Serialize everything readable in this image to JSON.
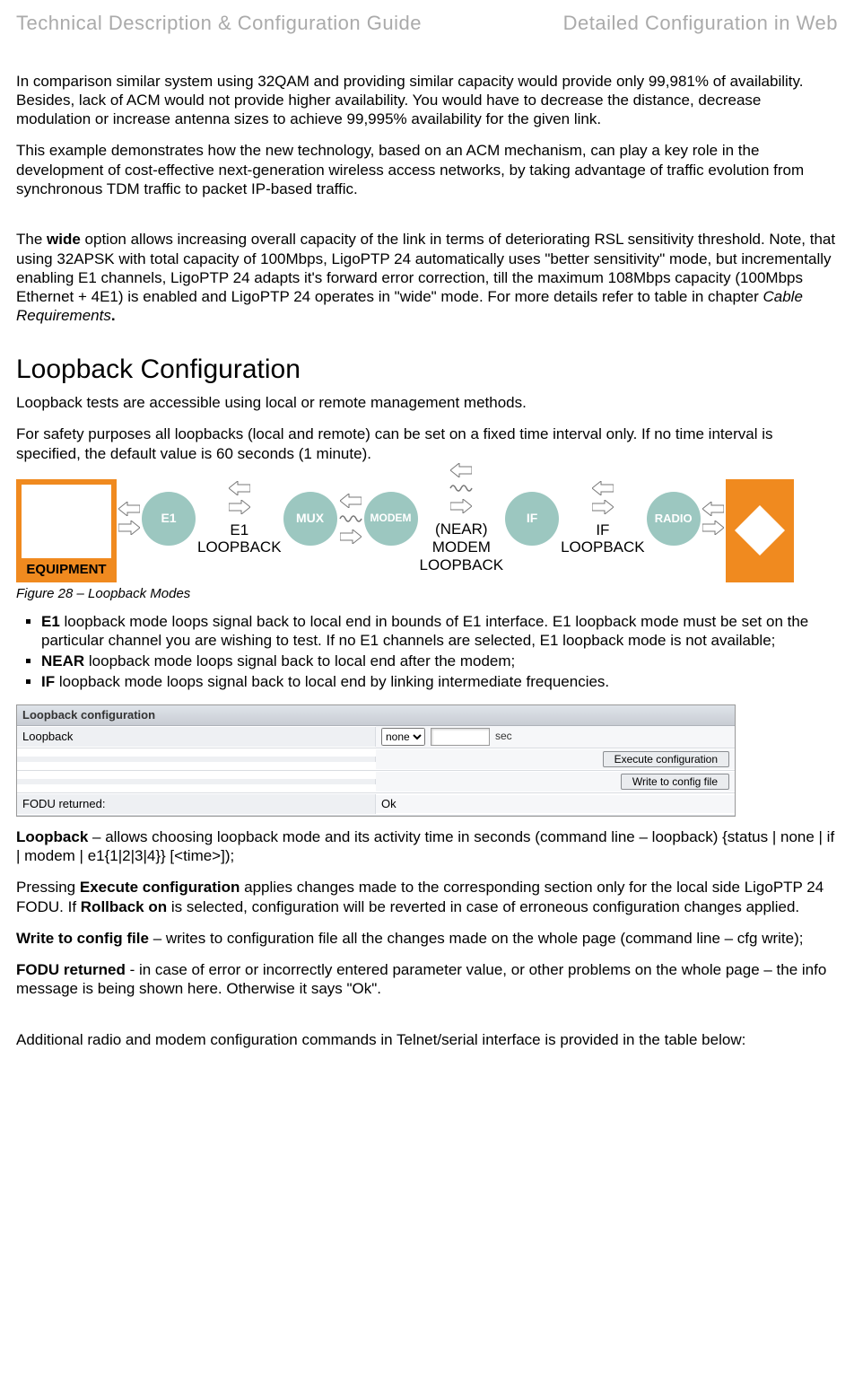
{
  "header": {
    "left": "Technical Description & Configuration Guide",
    "right": "Detailed Configuration in Web"
  },
  "intro": {
    "p1": "In comparison similar system using 32QAM and providing similar capacity would provide only 99,981% of availability. Besides, lack of ACM would not provide higher availability. You would have to decrease the distance, decrease modulation or increase antenna sizes to achieve 99,995% availability for the given link.",
    "p2": "This example demonstrates how the new technology, based on an ACM mechanism, can play a key role in the development of cost-effective next-generation wireless access networks, by taking advantage of traffic evolution from synchronous TDM traffic to packet IP-based traffic.",
    "wide_pre": "The ",
    "wide_bold": "wide",
    "wide_post": " option allows increasing overall capacity of the link in terms of deteriorating RSL sensitivity threshold. Note, that using 32APSK with total capacity of 100Mbps, LigoPTP 24 automatically uses \"better sensitivity\" mode, but incrementally enabling E1 channels, LigoPTP 24 adapts it's forward error correction, till the maximum 108Mbps capacity (100Mbps Ethernet + 4E1) is enabled and LigoPTP 24 operates in \"wide\" mode. For more details refer to table in chapter ",
    "wide_italic": "Cable Requirements",
    "wide_end": "."
  },
  "loopback": {
    "heading": "Loopback Configuration",
    "p1": "Loopback tests are accessible using local or remote management methods.",
    "p2": "For safety purposes all loopbacks (local and remote) can be set on a fixed time interval only. If no time interval is specified, the default value is 60 seconds (1 minute).",
    "diagram": {
      "equipment": "EQUIPMENT",
      "nodes": [
        "E1",
        "MUX",
        "MODEM",
        "IF",
        "RADIO"
      ],
      "lb1_t1": "E1",
      "lb1_t2": "LOOPBACK",
      "lb2_t1": "(NEAR)",
      "lb2_t2": "MODEM",
      "lb2_t3": "LOOPBACK",
      "lb3_t1": "IF",
      "lb3_t2": "LOOPBACK"
    },
    "figcap": "Figure 28 – Loopback Modes",
    "bullets": {
      "b1_b": "E1",
      "b1_t": " loopback mode loops signal back to local end in bounds of E1 interface. E1 loopback mode must be set on the particular channel you are wishing to test. If no E1 channels are selected, E1 loopback mode is not available;",
      "b2_b": "NEAR",
      "b2_t": " loopback mode loops signal back to local end after the modem;",
      "b3_b": "IF",
      "b3_t": " loopback mode loops signal back to local end by linking intermediate frequencies."
    }
  },
  "panel": {
    "title": "Loopback configuration",
    "row1_label": "Loopback",
    "row1_select": "none",
    "row1_unit": "sec",
    "btn_exec": "Execute configuration",
    "btn_write": "Write to config file",
    "row4_label": "FODU returned:",
    "row4_val": "Ok"
  },
  "after": {
    "p1_b": "Loopback",
    "p1_t": " – allows choosing loopback mode and its activity time in seconds (command line – loopback) {status | none | if | modem | e1{1|2|3|4}} [<time>]);",
    "p2_a": "Pressing ",
    "p2_b1": "Execute configuration",
    "p2_c": " applies changes made to the corresponding section only for the local side LigoPTP 24 FODU. If ",
    "p2_b2": "Rollback on",
    "p2_d": " is selected, configuration will be reverted in case of erroneous configuration changes applied.",
    "p3_b": "Write to config file",
    "p3_t": " – writes to configuration file all the changes made on the whole page (command line – cfg write);",
    "p4_b": "FODU returned",
    "p4_t": " - in case of error or incorrectly entered parameter value, or other problems on the whole page – the info message is being shown here. Otherwise it says \"Ok\".",
    "p5": "Additional radio and modem configuration commands in Telnet/serial interface is provided in the table below:"
  }
}
